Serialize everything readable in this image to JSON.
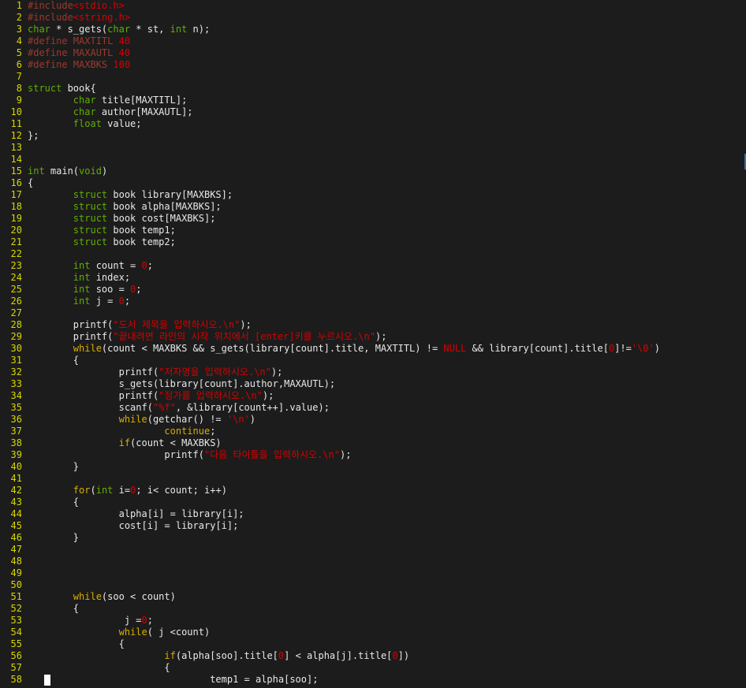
{
  "editor": {
    "colors": {
      "background": "#1c1c1c",
      "line_number": "#d7d700",
      "text": "#e8e8e8",
      "keyword": "#5faf00",
      "control": "#d7af00",
      "preprocessor": "#a0372d",
      "string": "#d70000",
      "cursor": "#ffffff"
    },
    "lines": [
      {
        "n": "1",
        "code": [
          [
            "pp",
            "#include"
          ],
          [
            "str",
            "<stdio.h>"
          ]
        ]
      },
      {
        "n": "2",
        "code": [
          [
            "pp",
            "#include"
          ],
          [
            "str",
            "<string.h>"
          ]
        ]
      },
      {
        "n": "3",
        "code": [
          [
            "ty",
            "char"
          ],
          [
            "p",
            " * s_gets("
          ],
          [
            "ty",
            "char"
          ],
          [
            "p",
            " * st, "
          ],
          [
            "ty",
            "int"
          ],
          [
            "p",
            " n);"
          ]
        ]
      },
      {
        "n": "4",
        "code": [
          [
            "pp",
            "#define MAXTITL "
          ],
          [
            "num",
            "40"
          ]
        ]
      },
      {
        "n": "5",
        "code": [
          [
            "pp",
            "#define MAXAUTL "
          ],
          [
            "num",
            "40"
          ]
        ]
      },
      {
        "n": "6",
        "code": [
          [
            "pp",
            "#define MAXBKS "
          ],
          [
            "num",
            "100"
          ]
        ]
      },
      {
        "n": "7",
        "code": []
      },
      {
        "n": "8",
        "code": [
          [
            "kw",
            "struct"
          ],
          [
            "p",
            " book{"
          ]
        ]
      },
      {
        "n": "9",
        "code": [
          [
            "p",
            "        "
          ],
          [
            "ty",
            "char"
          ],
          [
            "p",
            " title[MAXTITL];"
          ]
        ]
      },
      {
        "n": "10",
        "code": [
          [
            "p",
            "        "
          ],
          [
            "ty",
            "char"
          ],
          [
            "p",
            " author[MAXAUTL];"
          ]
        ]
      },
      {
        "n": "11",
        "code": [
          [
            "p",
            "        "
          ],
          [
            "ty",
            "float"
          ],
          [
            "p",
            " value;"
          ]
        ]
      },
      {
        "n": "12",
        "code": [
          [
            "p",
            "};"
          ]
        ]
      },
      {
        "n": "13",
        "code": []
      },
      {
        "n": "14",
        "code": []
      },
      {
        "n": "15",
        "code": [
          [
            "ty",
            "int"
          ],
          [
            "p",
            " main("
          ],
          [
            "ty",
            "void"
          ],
          [
            "p",
            ")"
          ]
        ]
      },
      {
        "n": "16",
        "code": [
          [
            "p",
            "{"
          ]
        ]
      },
      {
        "n": "17",
        "code": [
          [
            "p",
            "        "
          ],
          [
            "kw",
            "struct"
          ],
          [
            "p",
            " book library[MAXBKS];"
          ]
        ]
      },
      {
        "n": "18",
        "code": [
          [
            "p",
            "        "
          ],
          [
            "kw",
            "struct"
          ],
          [
            "p",
            " book alpha[MAXBKS];"
          ]
        ]
      },
      {
        "n": "19",
        "code": [
          [
            "p",
            "        "
          ],
          [
            "kw",
            "struct"
          ],
          [
            "p",
            " book cost[MAXBKS];"
          ]
        ]
      },
      {
        "n": "20",
        "code": [
          [
            "p",
            "        "
          ],
          [
            "kw",
            "struct"
          ],
          [
            "p",
            " book temp1;"
          ]
        ]
      },
      {
        "n": "21",
        "code": [
          [
            "p",
            "        "
          ],
          [
            "kw",
            "struct"
          ],
          [
            "p",
            " book temp2;"
          ]
        ]
      },
      {
        "n": "22",
        "code": []
      },
      {
        "n": "23",
        "code": [
          [
            "p",
            "        "
          ],
          [
            "ty",
            "int"
          ],
          [
            "p",
            " count = "
          ],
          [
            "num",
            "0"
          ],
          [
            "p",
            ";"
          ]
        ]
      },
      {
        "n": "24",
        "code": [
          [
            "p",
            "        "
          ],
          [
            "ty",
            "int"
          ],
          [
            "p",
            " index;"
          ]
        ]
      },
      {
        "n": "25",
        "code": [
          [
            "p",
            "        "
          ],
          [
            "ty",
            "int"
          ],
          [
            "p",
            " soo = "
          ],
          [
            "num",
            "0"
          ],
          [
            "p",
            ";"
          ]
        ]
      },
      {
        "n": "26",
        "code": [
          [
            "p",
            "        "
          ],
          [
            "ty",
            "int"
          ],
          [
            "p",
            " j = "
          ],
          [
            "num",
            "0"
          ],
          [
            "p",
            ";"
          ]
        ]
      },
      {
        "n": "27",
        "code": []
      },
      {
        "n": "28",
        "code": [
          [
            "p",
            "        printf("
          ],
          [
            "str",
            "\"도서 제목을 입력하시오.\\n\""
          ],
          [
            "p",
            ");"
          ]
        ]
      },
      {
        "n": "29",
        "code": [
          [
            "p",
            "        printf("
          ],
          [
            "str",
            "\"끝내려면 라인의 시작 위치에서 [enter]키를 누르시오.\\n\""
          ],
          [
            "p",
            ");"
          ]
        ]
      },
      {
        "n": "30",
        "code": [
          [
            "p",
            "        "
          ],
          [
            "ctl",
            "while"
          ],
          [
            "p",
            "(count < MAXBKS && s_gets(library[count].title, MAXTITL) != "
          ],
          [
            "nul",
            "NULL"
          ],
          [
            "p",
            " && library[count].title["
          ],
          [
            "num",
            "0"
          ],
          [
            "p",
            "]!="
          ],
          [
            "str",
            "'\\0'"
          ],
          [
            "p",
            ")"
          ]
        ]
      },
      {
        "n": "31",
        "code": [
          [
            "p",
            "        {"
          ]
        ]
      },
      {
        "n": "32",
        "code": [
          [
            "p",
            "                printf("
          ],
          [
            "str",
            "\"저자명을 입력하시오.\\n\""
          ],
          [
            "p",
            ");"
          ]
        ]
      },
      {
        "n": "33",
        "code": [
          [
            "p",
            "                s_gets(library[count].author,MAXAUTL);"
          ]
        ]
      },
      {
        "n": "34",
        "code": [
          [
            "p",
            "                printf("
          ],
          [
            "str",
            "\"정가를 입력하시오.\\n\""
          ],
          [
            "p",
            ");"
          ]
        ]
      },
      {
        "n": "35",
        "code": [
          [
            "p",
            "                scanf("
          ],
          [
            "str",
            "\"%f\""
          ],
          [
            "p",
            ", &library[count++].value);"
          ]
        ]
      },
      {
        "n": "36",
        "code": [
          [
            "p",
            "                "
          ],
          [
            "ctl",
            "while"
          ],
          [
            "p",
            "(getchar() != "
          ],
          [
            "str",
            "'\\n'"
          ],
          [
            "p",
            ")"
          ]
        ]
      },
      {
        "n": "37",
        "code": [
          [
            "p",
            "                        "
          ],
          [
            "ctl",
            "continue"
          ],
          [
            "p",
            ";"
          ]
        ]
      },
      {
        "n": "38",
        "code": [
          [
            "p",
            "                "
          ],
          [
            "ctl",
            "if"
          ],
          [
            "p",
            "(count < MAXBKS)"
          ]
        ]
      },
      {
        "n": "39",
        "code": [
          [
            "p",
            "                        printf("
          ],
          [
            "str",
            "\"다음 타이틀을 입력하시오.\\n\""
          ],
          [
            "p",
            ");"
          ]
        ]
      },
      {
        "n": "40",
        "code": [
          [
            "p",
            "        }"
          ]
        ]
      },
      {
        "n": "41",
        "code": []
      },
      {
        "n": "42",
        "code": [
          [
            "p",
            "        "
          ],
          [
            "ctl",
            "for"
          ],
          [
            "p",
            "("
          ],
          [
            "ty",
            "int"
          ],
          [
            "p",
            " i="
          ],
          [
            "num",
            "0"
          ],
          [
            "p",
            "; i< count; i++)"
          ]
        ]
      },
      {
        "n": "43",
        "code": [
          [
            "p",
            "        {"
          ]
        ]
      },
      {
        "n": "44",
        "code": [
          [
            "p",
            "                alpha[i] = library[i];"
          ]
        ]
      },
      {
        "n": "45",
        "code": [
          [
            "p",
            "                cost[i] = library[i];"
          ]
        ]
      },
      {
        "n": "46",
        "code": [
          [
            "p",
            "        }"
          ]
        ]
      },
      {
        "n": "47",
        "code": []
      },
      {
        "n": "48",
        "code": []
      },
      {
        "n": "49",
        "code": []
      },
      {
        "n": "50",
        "code": []
      },
      {
        "n": "51",
        "code": [
          [
            "p",
            "        "
          ],
          [
            "ctl",
            "while"
          ],
          [
            "p",
            "(soo < count)"
          ]
        ]
      },
      {
        "n": "52",
        "code": [
          [
            "p",
            "        {"
          ]
        ]
      },
      {
        "n": "53",
        "code": [
          [
            "p",
            "                 j ="
          ],
          [
            "num",
            "0"
          ],
          [
            "p",
            ";"
          ]
        ]
      },
      {
        "n": "54",
        "code": [
          [
            "p",
            "                "
          ],
          [
            "ctl",
            "while"
          ],
          [
            "p",
            "( j <count)"
          ]
        ]
      },
      {
        "n": "55",
        "code": [
          [
            "p",
            "                {"
          ]
        ]
      },
      {
        "n": "56",
        "code": [
          [
            "p",
            "                        "
          ],
          [
            "ctl",
            "if"
          ],
          [
            "p",
            "(alpha[soo].title["
          ],
          [
            "num",
            "0"
          ],
          [
            "p",
            "] < alpha[j].title["
          ],
          [
            "num",
            "0"
          ],
          [
            "p",
            "])"
          ]
        ]
      },
      {
        "n": "57",
        "code": [
          [
            "p",
            "                        {"
          ]
        ]
      },
      {
        "n": "58",
        "code": [
          [
            "p",
            "                                temp1 = alpha[soo];"
          ]
        ]
      }
    ]
  }
}
